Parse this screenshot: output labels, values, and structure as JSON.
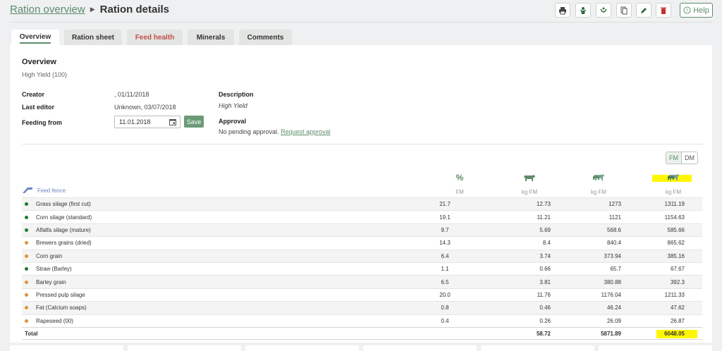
{
  "header": {
    "breadcrumb_parent": "Ration overview",
    "breadcrumb_current": "Ration details",
    "help_label": "Help"
  },
  "toolbar_icons": [
    "print-icon",
    "cow-animal-icon",
    "feed-analysis-icon",
    "copy-icon",
    "edit-icon",
    "delete-icon"
  ],
  "tabs": [
    {
      "label": "Overview",
      "active": true
    },
    {
      "label": "Ration sheet",
      "active": false
    },
    {
      "label": "Feed health",
      "active": false,
      "warning": true
    },
    {
      "label": "Minerals",
      "active": false
    },
    {
      "label": "Comments",
      "active": false
    }
  ],
  "overview": {
    "title": "Overview",
    "subtitle": "High Yield (100)",
    "creator_label": "Creator",
    "creator_value": ", 01/11/2018",
    "last_editor_label": "Last editor",
    "last_editor_value": "Unknown, 03/07/2018",
    "feeding_from_label": "Feeding from",
    "feeding_from_value": "11.01.2018",
    "save_label": "Save",
    "description_label": "Description",
    "description_value": "High Yield",
    "approval_label": "Approval",
    "approval_text": "No pending approval.",
    "approval_link": "Request approval"
  },
  "basis_toggle": {
    "fm": "FM",
    "dm": "DM",
    "selected": "FM"
  },
  "table": {
    "fence_label": "Feed fence",
    "columns": [
      {
        "icon": "percent",
        "symbol": "%",
        "unit": "FM"
      },
      {
        "icon": "cow-icon",
        "unit": "kg FM"
      },
      {
        "icon": "herd-icon",
        "unit": "kg FM"
      },
      {
        "icon": "herd-mixed-icon",
        "unit": "kg FM"
      }
    ],
    "rows": [
      {
        "name": "Grass silage (first cut)",
        "dot": "#1e7b34",
        "pct": "21.7",
        "kg1": "12.73",
        "kg2": "1273",
        "kg3": "1311.19"
      },
      {
        "name": "Corn silage (standard)",
        "dot": "#1e7b34",
        "pct": "19.1",
        "kg1": "11.21",
        "kg2": "1121",
        "kg3": "1154.63"
      },
      {
        "name": "Alfalfa silage (mature)",
        "dot": "#1e7b34",
        "pct": "9.7",
        "kg1": "5.69",
        "kg2": "568.6",
        "kg3": "585.66"
      },
      {
        "name": "Brewers grains (dried)",
        "dot": "#e0923a",
        "pct": "14.3",
        "kg1": "8.4",
        "kg2": "840.4",
        "kg3": "865.62"
      },
      {
        "name": "Corn grain",
        "dot": "#e0923a",
        "pct": "6.4",
        "kg1": "3.74",
        "kg2": "373.94",
        "kg3": "385.16"
      },
      {
        "name": "Straw (Barley)",
        "dot": "#1e7b34",
        "pct": "1.1",
        "kg1": "0.66",
        "kg2": "65.7",
        "kg3": "67.67"
      },
      {
        "name": "Barley grain",
        "dot": "#e0923a",
        "pct": "6.5",
        "kg1": "3.81",
        "kg2": "380.88",
        "kg3": "392.3"
      },
      {
        "name": "Pressed pulp silage",
        "dot": "#e0923a",
        "pct": "20.0",
        "kg1": "11.76",
        "kg2": "1176.04",
        "kg3": "1211.33"
      },
      {
        "name": "Fat (Calcium soaps)",
        "dot": "#e0923a",
        "pct": "0.8",
        "kg1": "0.46",
        "kg2": "46.24",
        "kg3": "47.62"
      },
      {
        "name": "Rapeseed (00)",
        "dot": "#e0923a",
        "pct": "0.4",
        "kg1": "0.26",
        "kg2": "26.09",
        "kg3": "26.87"
      }
    ],
    "total": {
      "label": "Total",
      "kg1": "58.72",
      "kg2": "5871.89",
      "kg3": "6048.05"
    }
  },
  "colors": {
    "accent": "#5d8c6b",
    "highlight": "#fff600",
    "delete": "#c9302c",
    "warning_tab": "#c0504d"
  }
}
